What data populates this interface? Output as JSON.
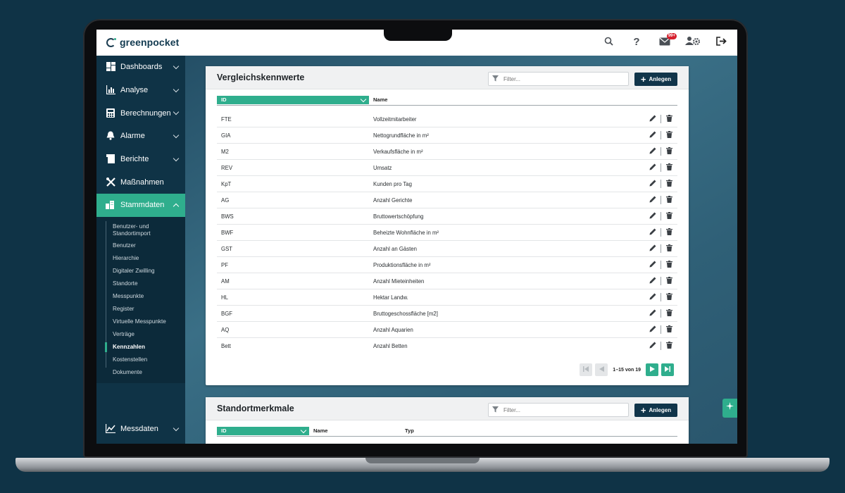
{
  "app": {
    "logo_text": "greenpocket"
  },
  "topbar": {
    "icons": [
      "search-icon",
      "help-icon",
      "mail-icon",
      "user-settings-icon",
      "logout-icon"
    ],
    "help_glyph": "?",
    "mail_badge": "99+"
  },
  "sidebar": {
    "items": [
      {
        "label": "Dashboards",
        "icon": "dashboard-icon"
      },
      {
        "label": "Analyse",
        "icon": "bar-chart-icon"
      },
      {
        "label": "Berechnungen",
        "icon": "calculator-icon"
      },
      {
        "label": "Alarme",
        "icon": "bell-icon"
      },
      {
        "label": "Berichte",
        "icon": "report-icon"
      },
      {
        "label": "Maßnahmen",
        "icon": "tools-icon"
      },
      {
        "label": "Stammdaten",
        "icon": "buildings-icon",
        "active": true
      },
      {
        "label": "Messdaten",
        "icon": "line-chart-icon"
      }
    ],
    "subitems": [
      "Benutzer- und Standortimport",
      "Benutzer",
      "Hierarchie",
      "Digitaler Zwilling",
      "Standorte",
      "Messpunkte",
      "Register",
      "Virtuelle Messpunkte",
      "Verträge",
      "Kennzahlen",
      "Kostenstellen",
      "Dokumente"
    ],
    "active_subitem": "Kennzahlen"
  },
  "panel1": {
    "title": "Vergleichskennwerte",
    "filter_placeholder": "Filter...",
    "add_label": "Anlegen",
    "col_id": "ID",
    "col_name": "Name",
    "rows": [
      {
        "id": "FTE",
        "name": "Vollzeitmitarbeiter"
      },
      {
        "id": "GIA",
        "name": "Nettogrundfläche in m²"
      },
      {
        "id": "M2",
        "name": "Verkaufsfläche in m²"
      },
      {
        "id": "REV",
        "name": "Umsatz"
      },
      {
        "id": "KpT",
        "name": "Kunden pro Tag"
      },
      {
        "id": "AG",
        "name": "Anzahl Gerichte"
      },
      {
        "id": "BWS",
        "name": "Bruttowertschöpfung"
      },
      {
        "id": "BWF",
        "name": "Beheizte Wohnfläche in m²"
      },
      {
        "id": "GST",
        "name": "Anzahl an Gästen"
      },
      {
        "id": "PF",
        "name": "Produktionsfläche in m²"
      },
      {
        "id": "AM",
        "name": "Anzahl Mieteinheiten"
      },
      {
        "id": "HL",
        "name": "Hektar Landw."
      },
      {
        "id": "BGF",
        "name": "Bruttogeschossfläche [m2]"
      },
      {
        "id": "AQ",
        "name": "Anzahl Aquarien"
      },
      {
        "id": "Bett",
        "name": "Anzahl Betten"
      }
    ],
    "pagination": "1–15 von 19"
  },
  "panel2": {
    "title": "Standortmerkmale",
    "filter_placeholder": "Filter...",
    "add_label": "Anlegen",
    "col_id": "ID",
    "col_name": "Name",
    "col_typ": "Typ"
  },
  "colors": {
    "accent": "#2fae8d",
    "navy": "#0f3346",
    "button": "#11354a"
  }
}
